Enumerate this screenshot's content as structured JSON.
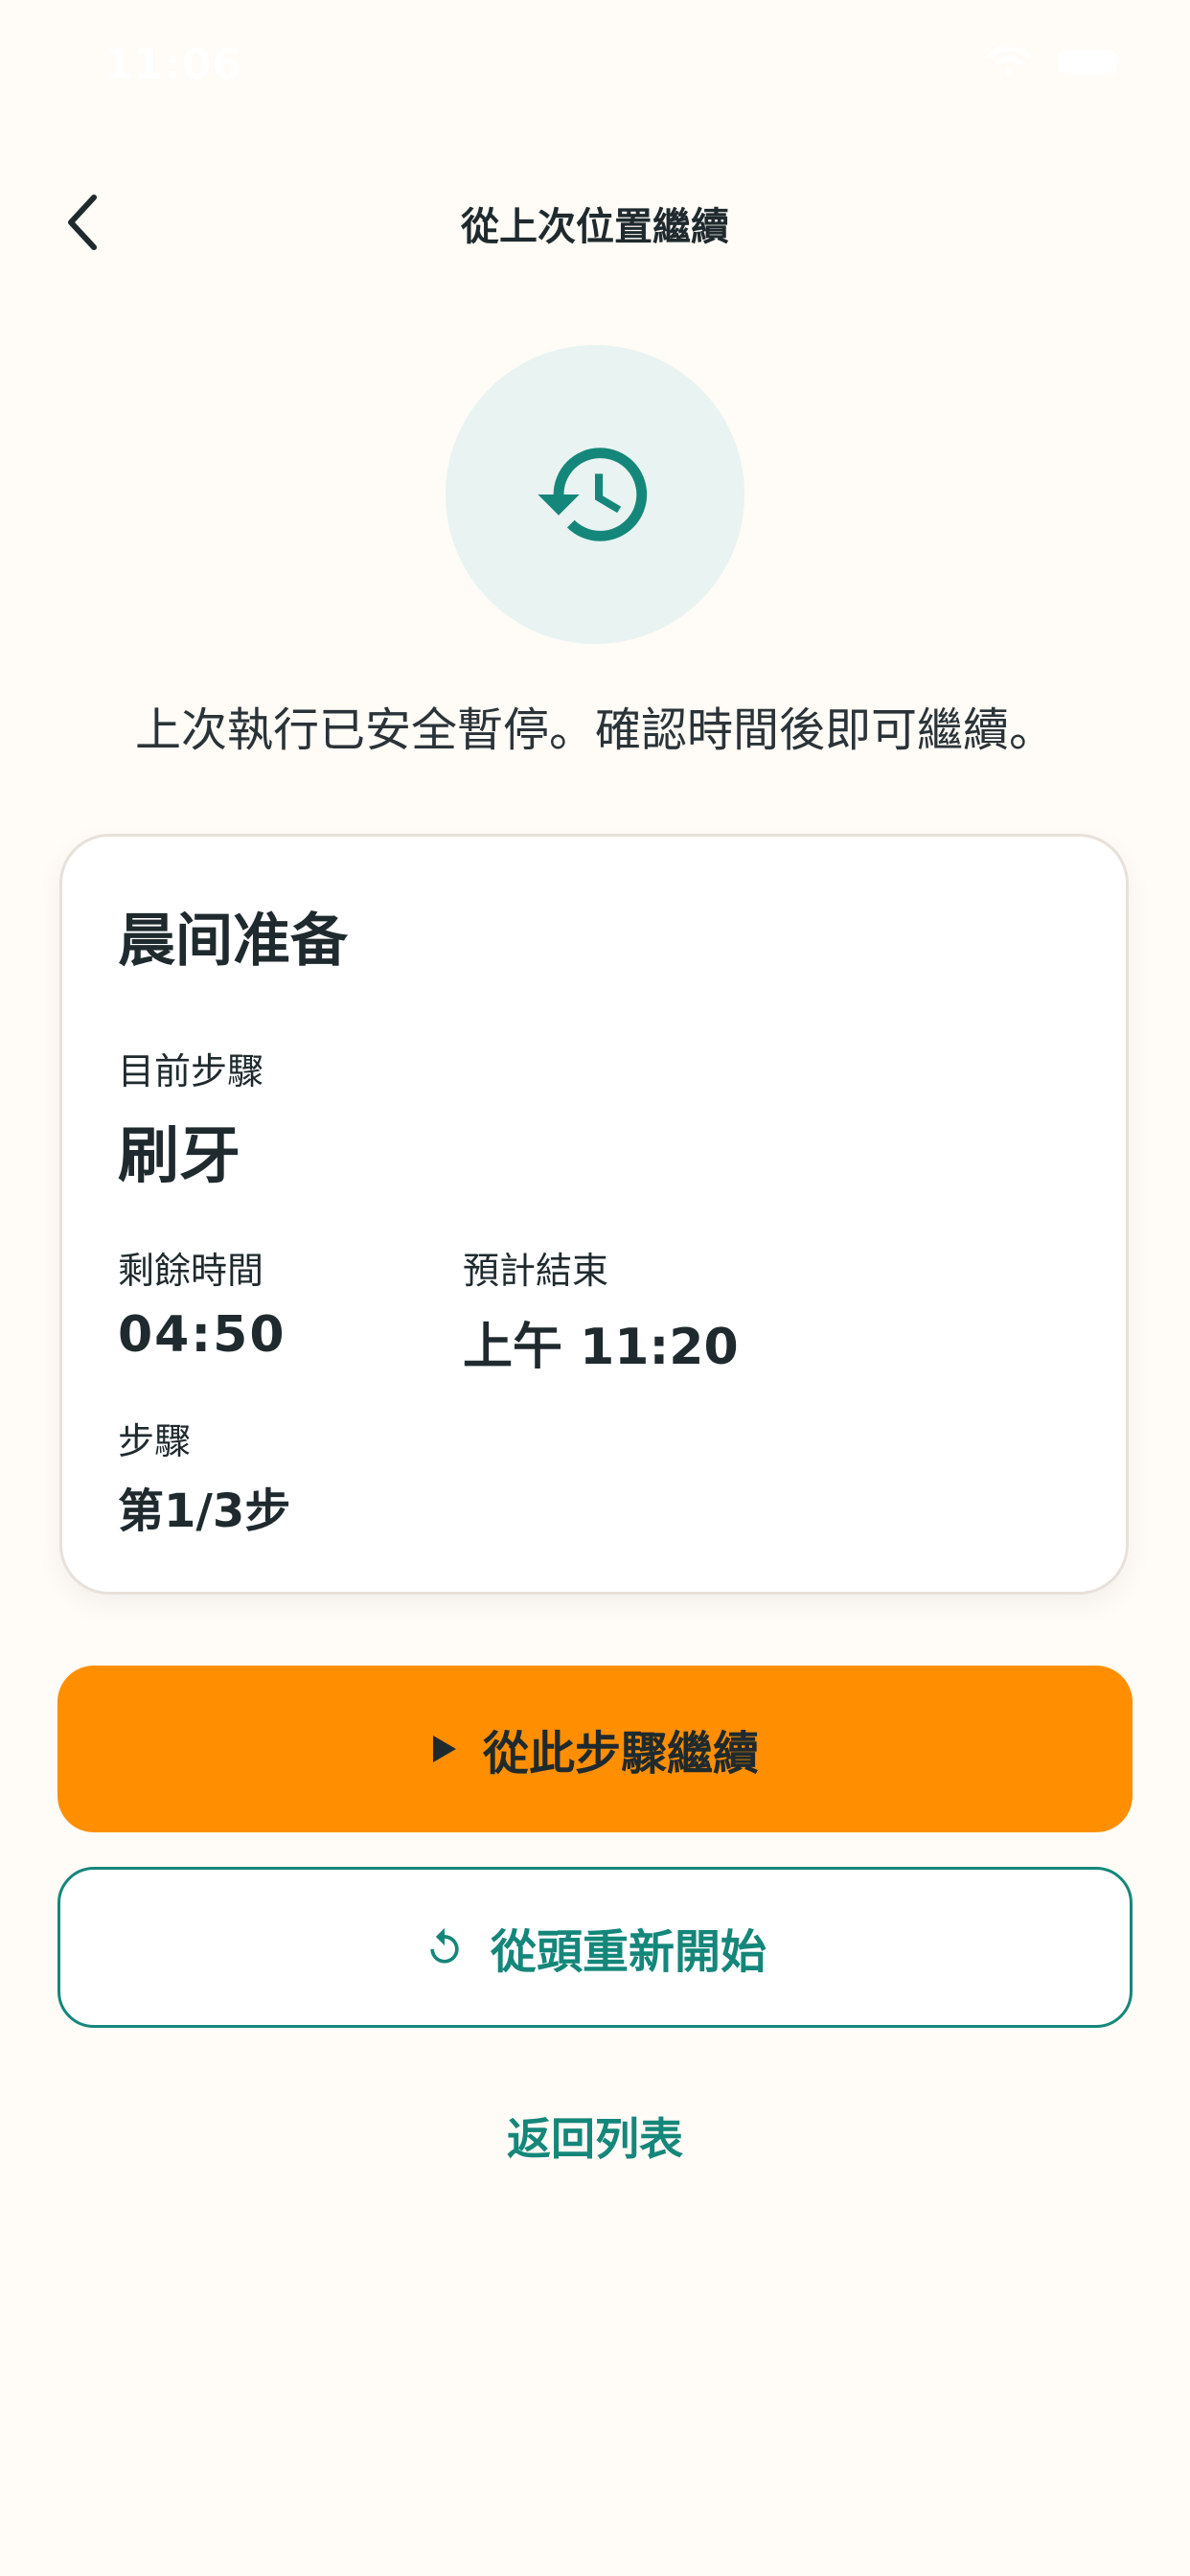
{
  "status_bar": {
    "time": "11:06"
  },
  "header": {
    "title": "從上次位置繼續"
  },
  "subtitle": "上次執行已安全暫停。確認時間後即可繼續。",
  "card": {
    "title": "晨间准备",
    "current_step_label": "目前步驟",
    "current_step_value": "刷牙",
    "remaining_label": "剩餘時間",
    "remaining_value": "04:50",
    "end_label": "預計結束",
    "end_value": "上午 11:20",
    "steps_label": "步驟",
    "steps_value": "第1/3步"
  },
  "buttons": {
    "resume_label": "從此步驟繼續",
    "restart_label": "從頭重新開始",
    "back_to_list_label": "返回列表"
  },
  "colors": {
    "background": "#FFFBF6",
    "accent_teal": "#14877A",
    "primary_orange": "#FF8F00",
    "icon_circle": "#E8F3F2"
  },
  "icons": [
    "back-chevron-icon",
    "history-icon",
    "play-icon",
    "restart-icon",
    "wifi-icon",
    "battery-icon"
  ]
}
